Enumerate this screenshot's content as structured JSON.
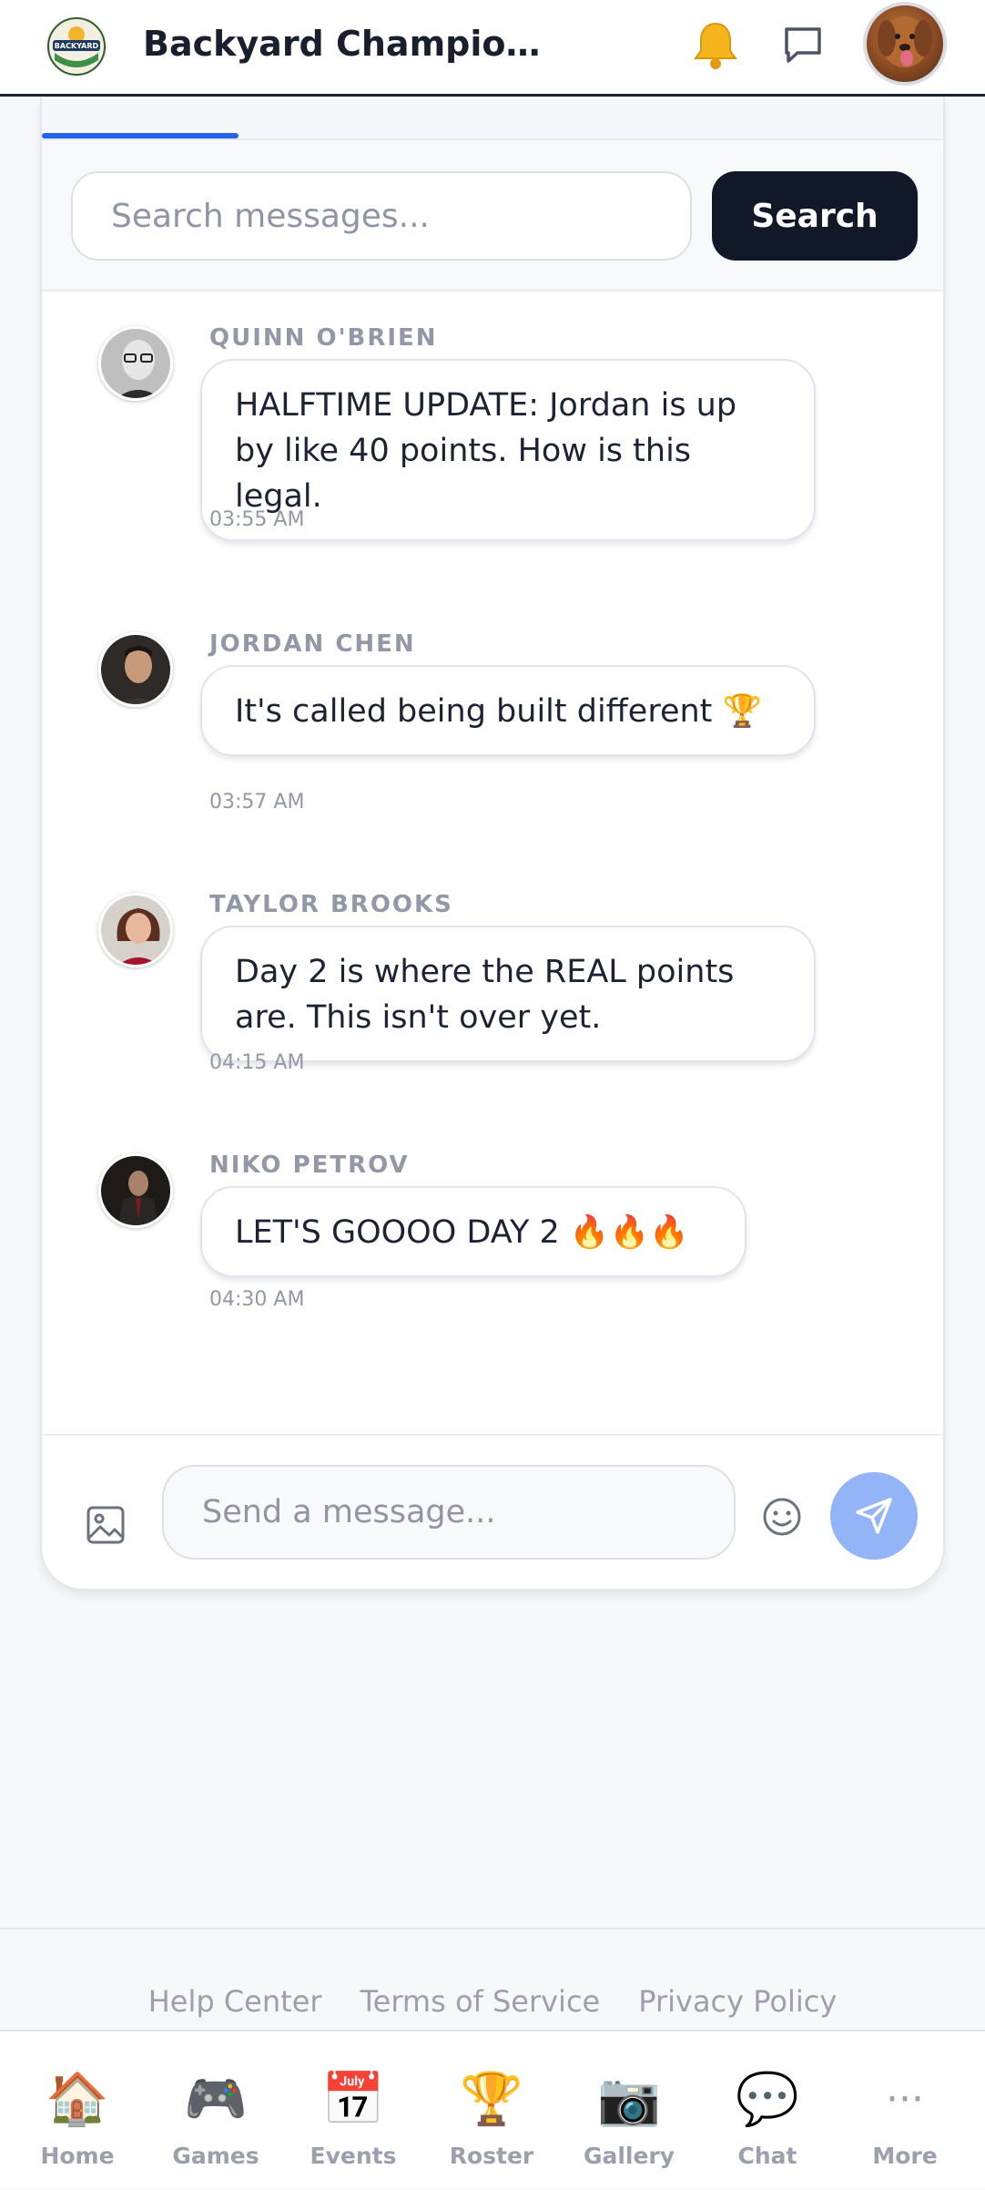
{
  "header": {
    "title": "Backyard Champio…",
    "logo_text": "BACKYARD",
    "icons": [
      "bell-icon",
      "chat-bubble-icon"
    ]
  },
  "search": {
    "placeholder": "Search messages...",
    "button_label": "Search"
  },
  "messages": [
    {
      "author": "QUINN O'BRIEN",
      "text": "HALFTIME UPDATE: Jordan is up by like 40 points. How is this legal.",
      "time": "03:55 AM"
    },
    {
      "author": "JORDAN CHEN",
      "text": "It's called being built different 🏆",
      "time": "03:57 AM"
    },
    {
      "author": "TAYLOR BROOKS",
      "text": "Day 2 is where the REAL points are. This isn't over yet.",
      "time": "04:15 AM"
    },
    {
      "author": "NIKO PETROV",
      "text": "LET'S GOOOO DAY 2 🔥🔥🔥",
      "time": "04:30 AM"
    }
  ],
  "composer": {
    "placeholder": "Send a message..."
  },
  "footer": {
    "links": [
      "Help Center",
      "Terms of Service",
      "Privacy Policy"
    ]
  },
  "nav": [
    {
      "label": "Home",
      "glyph": "🏠"
    },
    {
      "label": "Games",
      "glyph": "🎮"
    },
    {
      "label": "Events",
      "glyph": "📅"
    },
    {
      "label": "Roster",
      "glyph": "🏆"
    },
    {
      "label": "Gallery",
      "glyph": "📷"
    },
    {
      "label": "Chat",
      "glyph": "💬"
    },
    {
      "label": "More",
      "glyph": "···"
    }
  ],
  "colors": {
    "accent": "#2563eb",
    "search_button": "#111827",
    "send_button": "#93b4f7"
  }
}
